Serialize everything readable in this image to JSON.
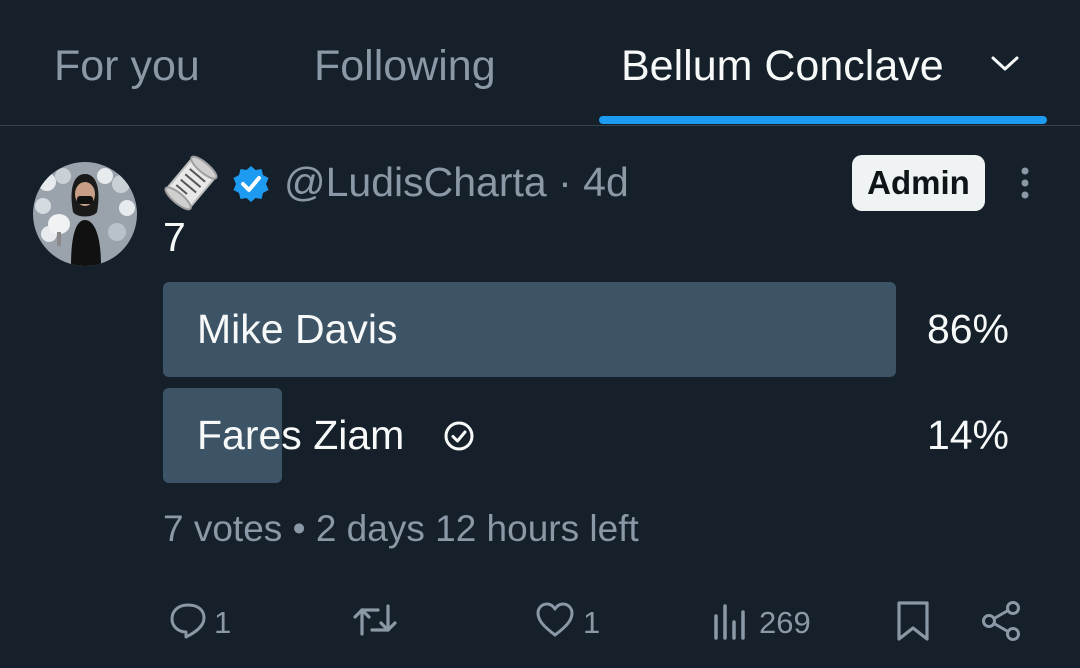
{
  "tabs": [
    {
      "label": "For you",
      "active": false
    },
    {
      "label": "Following",
      "active": false
    },
    {
      "label": "Bellum Conclave",
      "active": true
    }
  ],
  "post": {
    "author_handle": "@LudisCharta",
    "separator": "·",
    "age": "4d",
    "role_badge": "Admin",
    "text": "7",
    "icons": {
      "emoji": "scroll-icon",
      "verified": "verified-badge-icon",
      "more": "more-vertical-icon"
    },
    "colors": {
      "verified": "#1d9bf0",
      "accent": "#1d9bf0"
    }
  },
  "poll": {
    "options": [
      {
        "label": "Mike Davis",
        "percent": "86%",
        "share": 0.86,
        "selected": false
      },
      {
        "label": "Fares Ziam",
        "percent": "14%",
        "share": 0.14,
        "selected": true
      }
    ],
    "votes": "7 votes",
    "meta_separator": "•",
    "time_left": "2 days 12 hours left"
  },
  "actions": {
    "replies": "1",
    "reposts": "",
    "likes": "1",
    "views": "269"
  }
}
